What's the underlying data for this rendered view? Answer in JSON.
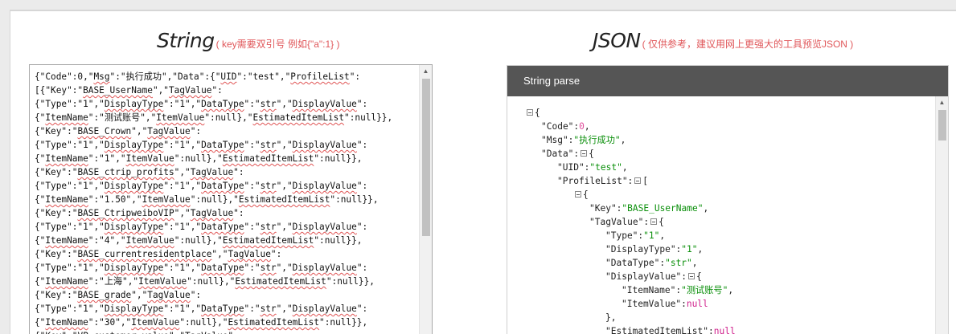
{
  "left": {
    "title": "String",
    "hint": "( key需要双引号 例如{\"a\":1} )",
    "lines": [
      "{\"Code\":0,\"Msg\":\"执行成功\",\"Data\":{\"UID\":\"test\",\"ProfileList\":",
      "[{\"Key\":\"BASE_UserName\",\"TagValue\":",
      "{\"Type\":\"1\",\"DisplayType\":\"1\",\"DataType\":\"str\",\"DisplayValue\":",
      "{\"ItemName\":\"测试账号\",\"ItemValue\":null},\"EstimatedItemList\":null}},",
      "{\"Key\":\"BASE_Crown\",\"TagValue\":",
      "{\"Type\":\"1\",\"DisplayType\":\"1\",\"DataType\":\"str\",\"DisplayValue\":",
      "{\"ItemName\":\"1\",\"ItemValue\":null},\"EstimatedItemList\":null}},",
      "{\"Key\":\"BASE_ctrip_profits\",\"TagValue\":",
      "{\"Type\":\"1\",\"DisplayType\":\"1\",\"DataType\":\"str\",\"DisplayValue\":",
      "{\"ItemName\":\"1.50\",\"ItemValue\":null},\"EstimatedItemList\":null}},",
      "{\"Key\":\"BASE_CtripweiboVIP\",\"TagValue\":",
      "{\"Type\":\"1\",\"DisplayType\":\"1\",\"DataType\":\"str\",\"DisplayValue\":",
      "{\"ItemName\":\"4\",\"ItemValue\":null},\"EstimatedItemList\":null}},",
      "{\"Key\":\"BASE_currentresidentplace\",\"TagValue\":",
      "{\"Type\":\"1\",\"DisplayType\":\"1\",\"DataType\":\"str\",\"DisplayValue\":",
      "{\"ItemName\":\"上海\",\"ItemValue\":null},\"EstimatedItemList\":null}},",
      "{\"Key\":\"BASE_grade\",\"TagValue\":",
      "{\"Type\":\"1\",\"DisplayType\":\"1\",\"DataType\":\"str\",\"DisplayValue\":",
      "{\"ItemName\":\"30\",\"ItemValue\":null},\"EstimatedItemList\":null}},",
      "{\"Key\":\"VP_customer_value\",\"TagValue\":"
    ]
  },
  "right": {
    "title": "JSON",
    "hint": "( 仅供参考，建议用网上更强大的工具预览JSON )",
    "panel_title": "String parse",
    "tree": [
      {
        "indent": 0,
        "toggle": true,
        "parts": [
          [
            "p",
            "{"
          ]
        ]
      },
      {
        "indent": 1,
        "toggle": false,
        "parts": [
          [
            "k",
            "\"Code\":"
          ],
          [
            "num",
            "0"
          ],
          [
            "p",
            ","
          ]
        ]
      },
      {
        "indent": 1,
        "toggle": false,
        "parts": [
          [
            "k",
            "\"Msg\":"
          ],
          [
            "str",
            "\"执行成功\""
          ],
          [
            "p",
            ","
          ]
        ]
      },
      {
        "indent": 1,
        "toggle": true,
        "parts": [
          [
            "k",
            "\"Data\":"
          ],
          [
            "p",
            "{"
          ]
        ]
      },
      {
        "indent": 2,
        "toggle": false,
        "parts": [
          [
            "k",
            "\"UID\":"
          ],
          [
            "str",
            "\"test\""
          ],
          [
            "p",
            ","
          ]
        ]
      },
      {
        "indent": 2,
        "toggle": true,
        "parts": [
          [
            "k",
            "\"ProfileList\":"
          ],
          [
            "p",
            "["
          ]
        ]
      },
      {
        "indent": 3,
        "toggle": true,
        "parts": [
          [
            "p",
            "{"
          ]
        ]
      },
      {
        "indent": 4,
        "toggle": false,
        "parts": [
          [
            "k",
            "\"Key\":"
          ],
          [
            "str",
            "\"BASE_UserName\""
          ],
          [
            "p",
            ","
          ]
        ]
      },
      {
        "indent": 4,
        "toggle": true,
        "parts": [
          [
            "k",
            "\"TagValue\":"
          ],
          [
            "p",
            "{"
          ]
        ]
      },
      {
        "indent": 5,
        "toggle": false,
        "parts": [
          [
            "k",
            "\"Type\":"
          ],
          [
            "str",
            "\"1\""
          ],
          [
            "p",
            ","
          ]
        ]
      },
      {
        "indent": 5,
        "toggle": false,
        "parts": [
          [
            "k",
            "\"DisplayType\":"
          ],
          [
            "str",
            "\"1\""
          ],
          [
            "p",
            ","
          ]
        ]
      },
      {
        "indent": 5,
        "toggle": false,
        "parts": [
          [
            "k",
            "\"DataType\":"
          ],
          [
            "str",
            "\"str\""
          ],
          [
            "p",
            ","
          ]
        ]
      },
      {
        "indent": 5,
        "toggle": true,
        "parts": [
          [
            "k",
            "\"DisplayValue\":"
          ],
          [
            "p",
            "{"
          ]
        ]
      },
      {
        "indent": 6,
        "toggle": false,
        "parts": [
          [
            "k",
            "\"ItemName\":"
          ],
          [
            "str",
            "\"测试账号\""
          ],
          [
            "p",
            ","
          ]
        ]
      },
      {
        "indent": 6,
        "toggle": false,
        "parts": [
          [
            "k",
            "\"ItemValue\":"
          ],
          [
            "null",
            "null"
          ]
        ]
      },
      {
        "indent": 5,
        "toggle": false,
        "parts": [
          [
            "p",
            "},"
          ]
        ]
      },
      {
        "indent": 5,
        "toggle": false,
        "parts": [
          [
            "k",
            "\"EstimatedItemList\":"
          ],
          [
            "null",
            "null"
          ]
        ]
      }
    ]
  },
  "icons": {
    "up": "arrow-up-icon",
    "collapse": "collapse-minus-icon"
  }
}
